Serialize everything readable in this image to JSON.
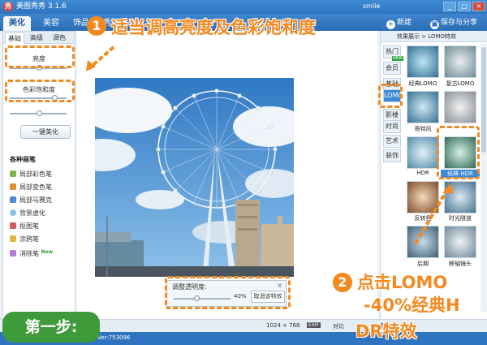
{
  "titlebar": {
    "title": "美图秀秀 3.1.6",
    "user": "smile",
    "buttons": [
      "_",
      "□",
      "×"
    ]
  },
  "main_tabs": [
    "美化",
    "美容",
    "饰品",
    "秀与分享"
  ],
  "toolbar": {
    "new_label": "新建",
    "save_label": "保存与分享"
  },
  "left_panel": {
    "subtabs": [
      "基础",
      "高级",
      "调色"
    ],
    "sliders": [
      {
        "label": "亮度",
        "value": 0.5
      },
      {
        "label": "色彩饱和度",
        "value": 0.78
      },
      {
        "label": "",
        "value": 0.5
      }
    ],
    "beautify_button": "一键美化",
    "section_title": "各种画笔",
    "tools": [
      {
        "label": "局部彩色笔",
        "color": "#7ab648"
      },
      {
        "label": "局部变色笔",
        "color": "#e48a2c"
      },
      {
        "label": "局部马赛克",
        "color": "#4a8ad0"
      },
      {
        "label": "背景虚化",
        "color": "#8cc0e6"
      },
      {
        "label": "抠图笔",
        "color": "#d85a5a"
      },
      {
        "label": "涂鸦笔",
        "color": "#e0b53a"
      },
      {
        "label": "消除笔",
        "color": "#b57ad6",
        "badge": "New"
      }
    ]
  },
  "opacity_panel": {
    "label": "调整透明度:",
    "value": "40%",
    "value_fraction": 0.4,
    "cancel_label": "取消该特效",
    "close": "×"
  },
  "right_panel": {
    "header": "效果展示 > LOMO特效",
    "categories": [
      {
        "label": "热门",
        "active": false
      },
      {
        "label": "会员",
        "active": false,
        "badge": "NEW"
      },
      {
        "label": "基础",
        "active": false
      },
      {
        "label": "LOMO",
        "active": true
      },
      {
        "label": "影楼",
        "active": false
      },
      {
        "label": "时尚",
        "active": false
      },
      {
        "label": "艺术",
        "active": false
      },
      {
        "label": "装饰",
        "active": false
      }
    ],
    "thumbnails": [
      {
        "label": "经典LOMO"
      },
      {
        "label": "复古LOMO"
      },
      {
        "label": ""
      },
      {
        "label": "哥特风"
      },
      {
        "label": "HDR"
      },
      {
        "label": "经典 HDR",
        "selected": true
      },
      {
        "label": "反转色"
      },
      {
        "label": "时光隧道"
      },
      {
        "label": "后期"
      },
      {
        "label": "移轴镜头"
      }
    ]
  },
  "statusbar": {
    "dimensions": "1024 × 768",
    "exif": "EXIF",
    "compare": "对比",
    "original": "原图",
    "bottom_text": "Ver:753096"
  },
  "annotations": {
    "step1_number": "1",
    "step1_text": "适当调高亮度及色彩饱和度",
    "step2_number": "2",
    "step2_line1": "点击LOMO",
    "step2_line2": "-40%经典H",
    "step2_line3": "DR特效",
    "step_label": "第一步:"
  },
  "colors": {
    "accent": "#f4891f",
    "title_blue": "#2f74c0",
    "step_green": "#3f9b3a"
  }
}
